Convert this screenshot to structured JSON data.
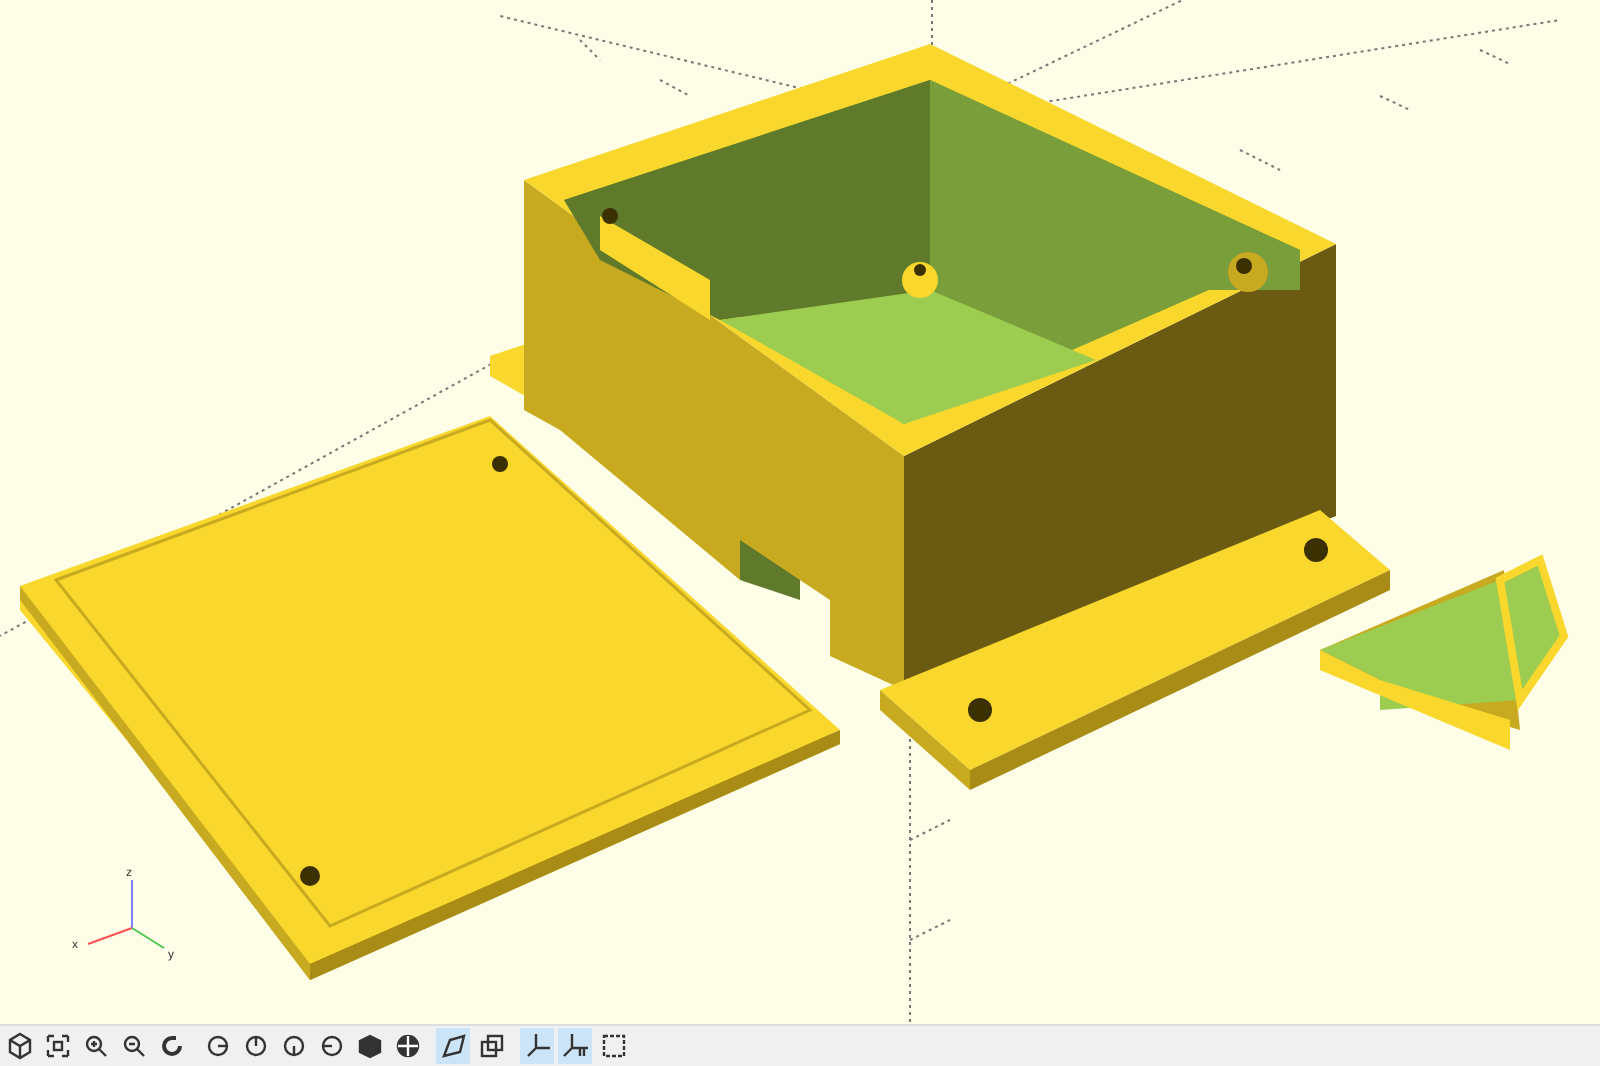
{
  "viewport": {
    "axes_labels": [
      "x",
      "y",
      "z"
    ]
  },
  "toolbar": [
    {
      "kind": "render",
      "selected": false
    },
    {
      "kind": "view-all",
      "selected": false
    },
    {
      "kind": "zoom-in",
      "selected": false
    },
    {
      "kind": "zoom-out",
      "selected": false
    },
    {
      "kind": "reset",
      "selected": false
    },
    {
      "kind": "right",
      "selected": false
    },
    {
      "kind": "top",
      "selected": false
    },
    {
      "kind": "bottom",
      "selected": false
    },
    {
      "kind": "left",
      "selected": false
    },
    {
      "kind": "front",
      "selected": false
    },
    {
      "kind": "back",
      "selected": false
    },
    {
      "kind": "perspective",
      "selected": true
    },
    {
      "kind": "orthogonal",
      "selected": false
    },
    {
      "kind": "axes",
      "selected": true
    },
    {
      "kind": "scale-markers",
      "selected": true
    },
    {
      "kind": "edges",
      "selected": false
    }
  ]
}
